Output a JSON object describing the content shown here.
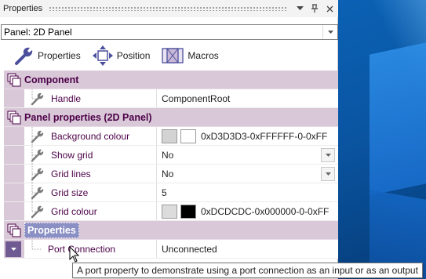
{
  "panel": {
    "title": "Properties",
    "titlebar_buttons": [
      "chevron-down-icon",
      "pin-icon",
      "close-icon"
    ]
  },
  "selector": {
    "value": "Panel: 2D Panel"
  },
  "toolbar": {
    "properties_label": "Properties",
    "position_label": "Position",
    "macros_label": "Macros"
  },
  "grid": {
    "categories": [
      {
        "label": "Component",
        "rows": [
          {
            "name": "Handle",
            "value": "ComponentRoot"
          }
        ]
      },
      {
        "label": "Panel properties (2D Panel)",
        "rows": [
          {
            "name": "Background colour",
            "value": "0xD3D3D3-0xFFFFFF-0-0xFF",
            "swatches": [
              "#d3d3d3",
              "#ffffff"
            ]
          },
          {
            "name": "Show grid",
            "value": "No",
            "dropdown": true
          },
          {
            "name": "Grid lines",
            "value": "No",
            "dropdown": true
          },
          {
            "name": "Grid size",
            "value": "5"
          },
          {
            "name": "Grid colour",
            "value": "0xDCDCDC-0x000000-0-0xFF",
            "swatches": [
              "#dcdcdc",
              "#000000"
            ]
          }
        ]
      },
      {
        "label": "Properties",
        "rows": [
          {
            "name": "Port Connection",
            "value": "Unconnected"
          }
        ]
      }
    ]
  },
  "tooltip": "A port property to demonstrate using a port connection as an input or as an output",
  "colors": {
    "category_bg": "#d9c8d7",
    "category_text": "#4b0048",
    "selected_label_bg": "#8a8fc4",
    "gutter_selected": "#6f5a92"
  }
}
